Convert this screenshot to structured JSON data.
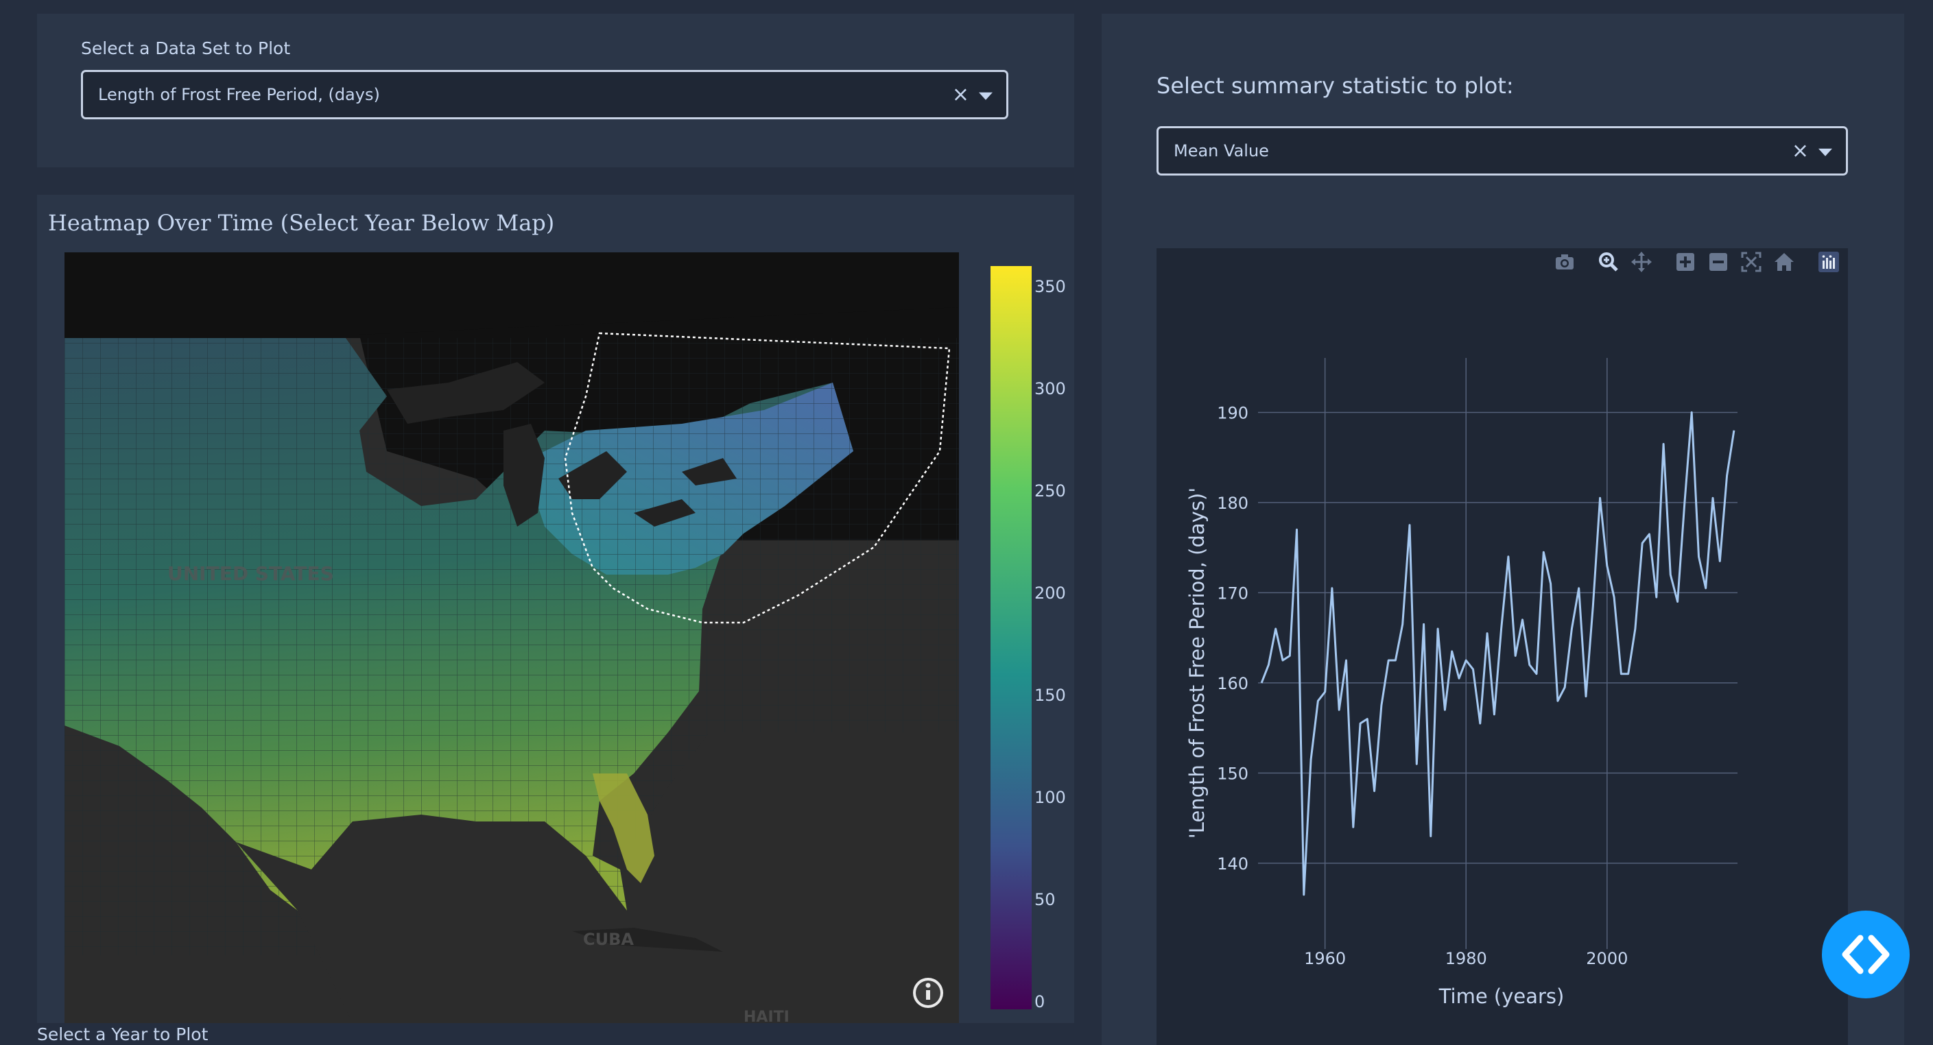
{
  "dataset": {
    "label": "Select a Data Set to Plot",
    "value": "Length of Frost Free Period, (days)",
    "clear": "×"
  },
  "heatmap": {
    "title": "Heatmap Over Time (Select Year Below Map)",
    "map_labels": {
      "country": "UNITED STATES",
      "cuba": "CUBA",
      "haiti": "HAITI"
    },
    "colorbar": {
      "ticks": [
        "350",
        "300",
        "250",
        "200",
        "150",
        "100",
        "50",
        "0"
      ],
      "colors": [
        "#fde725",
        "#5ec962",
        "#21918c",
        "#3b528b",
        "#440154"
      ]
    }
  },
  "statistic": {
    "label": "Select summary statistic to plot:",
    "value": "Mean Value",
    "clear": "×"
  },
  "toolbar": {
    "icons": [
      "camera-icon",
      "zoom-icon",
      "pan-icon",
      "zoom-in-icon",
      "zoom-out-icon",
      "autoscale-icon",
      "reset-axes-icon",
      "plotly-logo-icon"
    ]
  },
  "chart_data": {
    "type": "line",
    "xlabel": "Time (years)",
    "ylabel": "'Length of Frost Free Period, (days)'",
    "xlim": [
      1950.5,
      2018.5
    ],
    "ylim": [
      132,
      193
    ],
    "x_ticks": [
      1960,
      1980,
      2000
    ],
    "y_ticks": [
      140,
      150,
      160,
      170,
      180,
      190
    ],
    "grid": true,
    "series": [
      {
        "color": "#a5c8f0",
        "x": [
          1951,
          1952,
          1953,
          1954,
          1955,
          1956,
          1957,
          1958,
          1959,
          1960,
          1961,
          1962,
          1963,
          1964,
          1965,
          1966,
          1967,
          1968,
          1969,
          1970,
          1971,
          1972,
          1973,
          1974,
          1975,
          1976,
          1977,
          1978,
          1979,
          1980,
          1981,
          1982,
          1983,
          1984,
          1985,
          1986,
          1987,
          1988,
          1989,
          1990,
          1991,
          1992,
          1993,
          1994,
          1995,
          1996,
          1997,
          1998,
          1999,
          2000,
          2001,
          2002,
          2003,
          2004,
          2005,
          2006,
          2007,
          2008,
          2009,
          2010,
          2011,
          2012,
          2013,
          2014,
          2015,
          2016,
          2017,
          2018
        ],
        "y": [
          160,
          162,
          166,
          162.5,
          163,
          177,
          136.5,
          151.5,
          158,
          159,
          170.5,
          157,
          162.5,
          144,
          155.5,
          156,
          148,
          157.5,
          162.5,
          162.5,
          166.5,
          177.5,
          151,
          166.5,
          143,
          166,
          157,
          163.5,
          160.5,
          162.5,
          161.5,
          155.5,
          165.5,
          156.5,
          166,
          174,
          163,
          167,
          162,
          161,
          174.5,
          171,
          158,
          159.5,
          166,
          170.5,
          158.5,
          168.5,
          180.5,
          173,
          169.5,
          161,
          161,
          166,
          175.5,
          176.5,
          169.5,
          186.5,
          172,
          169,
          180,
          190,
          174,
          170.5,
          180.5,
          173.5,
          183,
          188
        ]
      }
    ]
  },
  "year_label": "Select a Year to Plot",
  "fab": {
    "icon": "code-icon",
    "glyph": "< >"
  }
}
